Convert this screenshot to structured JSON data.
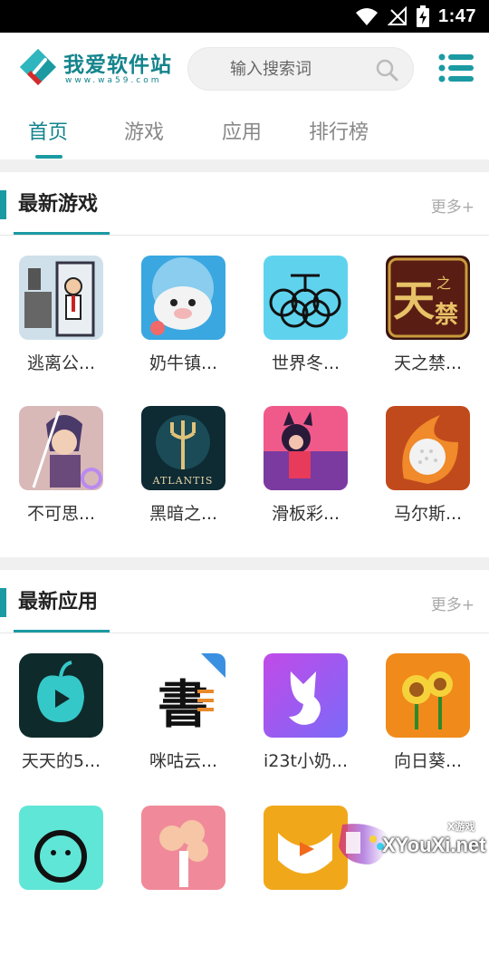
{
  "status": {
    "time": "1:47"
  },
  "header": {
    "logo_text": "我爱软件站",
    "logo_sub": "www.wa59.com",
    "search_placeholder": "输入搜索词"
  },
  "tabs": [
    {
      "label": "首页",
      "active": true
    },
    {
      "label": "游戏",
      "active": false
    },
    {
      "label": "应用",
      "active": false
    },
    {
      "label": "排行榜",
      "active": false
    }
  ],
  "sections": {
    "games": {
      "title": "最新游戏",
      "more": "更多+",
      "items": [
        {
          "label": "逃离公...",
          "icon": "office-escape-icon"
        },
        {
          "label": "奶牛镇...",
          "icon": "cow-town-icon"
        },
        {
          "label": "世界冬...",
          "icon": "olympic-bike-icon"
        },
        {
          "label": "天之禁...",
          "icon": "tianzhijin-icon"
        },
        {
          "label": "不可思...",
          "icon": "sword-girl-icon"
        },
        {
          "label": "黑暗之...",
          "icon": "atlantis-trident-icon"
        },
        {
          "label": "滑板彩...",
          "icon": "skateboard-girl-icon"
        },
        {
          "label": "马尔斯...",
          "icon": "golf-ball-fire-icon"
        }
      ]
    },
    "apps": {
      "title": "最新应用",
      "more": "更多+",
      "items": [
        {
          "label": "天天的5...",
          "icon": "apple-play-icon"
        },
        {
          "label": "咪咕云...",
          "icon": "migu-cloud-icon"
        },
        {
          "label": "i23t小奶...",
          "icon": "fox-icon"
        },
        {
          "label": "向日葵...",
          "icon": "sunflower-icon"
        },
        {
          "label": "",
          "icon": "smiley-icon"
        },
        {
          "label": "",
          "icon": "pink-tree-icon"
        },
        {
          "label": "",
          "icon": "play-cup-icon"
        }
      ]
    }
  },
  "watermark": {
    "text": "XYouXi.net",
    "small": "X游戏"
  },
  "colors": {
    "accent": "#1b9aa2",
    "brand": "#14848c"
  }
}
